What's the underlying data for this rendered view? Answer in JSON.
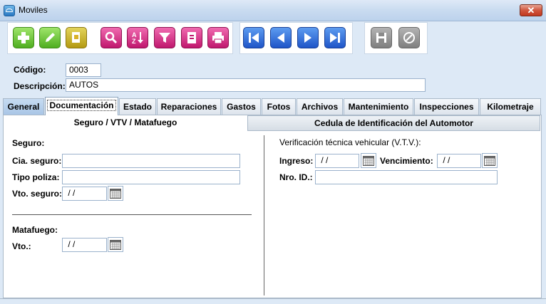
{
  "window": {
    "title": "Moviles",
    "close": "✕"
  },
  "header": {
    "codigo_label": "Código:",
    "codigo_value": "0003",
    "descripcion_label": "Descripción:",
    "descripcion_value": "AUTOS"
  },
  "tabs": [
    "General",
    "Documentación",
    "Estado",
    "Reparaciones",
    "Gastos",
    "Fotos",
    "Archivos",
    "Mantenimiento",
    "Inspecciones",
    "Kilometraje"
  ],
  "subtabs": {
    "active": "Seguro / VTV / Matafuego",
    "other": "Cedula de Identificación del Automotor"
  },
  "seguro": {
    "section": "Seguro:",
    "cia_label": "Cia. seguro:",
    "cia_value": "",
    "tipo_label": "Tipo poliza:",
    "tipo_value": "",
    "vto_label": "Vto. seguro:",
    "vto_value": " / /"
  },
  "matafuego": {
    "section": "Matafuego:",
    "vto_label": "Vto.:",
    "vto_value": " / /"
  },
  "vtv": {
    "section": "Verificación técnica vehicular (V.T.V.):",
    "ingreso_label": "Ingreso:",
    "ingreso_value": " / /",
    "venc_label": "Vencimiento:",
    "venc_value": " / /",
    "nro_label": "Nro. ID.:",
    "nro_value": ""
  },
  "toolbar": [
    "add-icon",
    "edit-icon",
    "copy-icon",
    "search-icon",
    "sort-az-icon",
    "filter-icon",
    "report-icon",
    "print-icon",
    "first-icon",
    "prev-icon",
    "next-icon",
    "last-icon",
    "save-icon",
    "cancel-icon"
  ]
}
